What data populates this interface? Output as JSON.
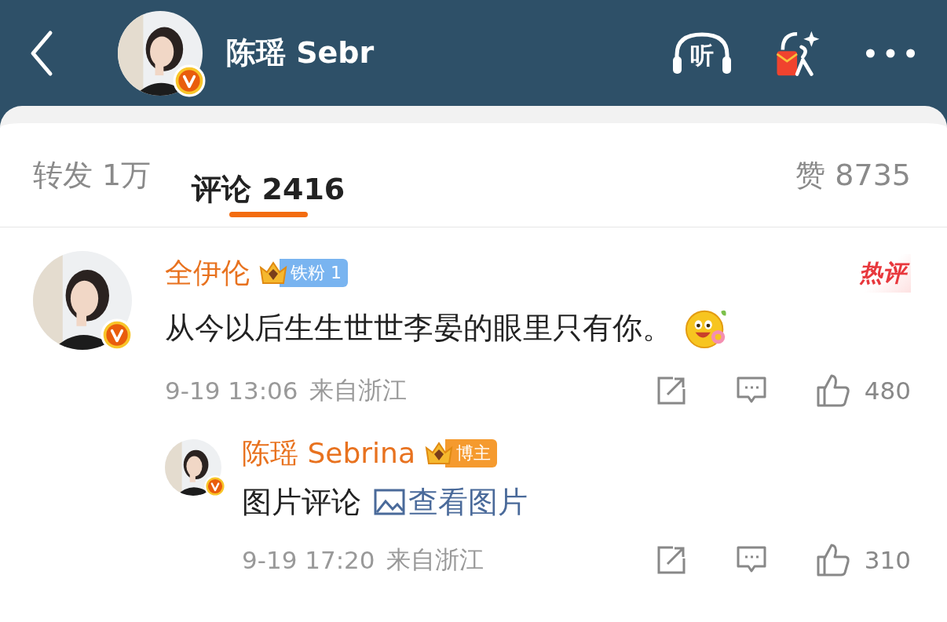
{
  "header": {
    "title": "陈瑶 Sebr",
    "listen_label": "听"
  },
  "tabs": [
    {
      "label": "转发 1万",
      "selected": false
    },
    {
      "label": "评论 2416",
      "selected": true
    },
    {
      "label": "赞 8735",
      "selected": false
    }
  ],
  "comments": [
    {
      "name": "全伊伦",
      "badge": {
        "kind": "fan",
        "label": "铁粉 1"
      },
      "hot_label": "热评",
      "text": "从今以后生生世世李晏的眼里只有你。",
      "emoji": true,
      "time": "9-19 13:06",
      "location": "来自浙江",
      "likes": "480",
      "replies": [
        {
          "name": "陈瑶 Sebrina",
          "badge": {
            "kind": "author",
            "label": "博主"
          },
          "text": "图片评论",
          "link": "查看图片",
          "time": "9-19 17:20",
          "location": "来自浙江",
          "likes": "310"
        }
      ]
    }
  ]
}
